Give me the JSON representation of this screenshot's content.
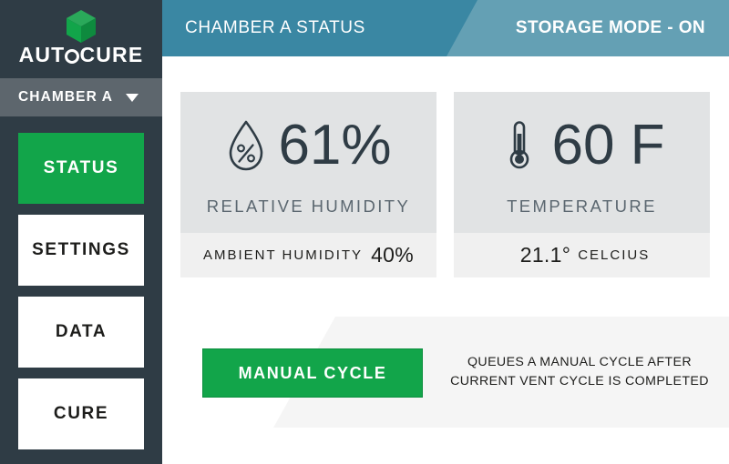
{
  "brand": {
    "logo_icon": "green-cube-icon",
    "name_part1": "AUT",
    "name_part2": "CURE",
    "full_name": "AUTOCURE",
    "accent_color": "#12a54a",
    "sidebar_color": "#2f3c45"
  },
  "sidebar": {
    "chamber_select": {
      "value": "CHAMBER A",
      "caret_icon": "chevron-down-icon"
    },
    "nav_items": [
      {
        "label": "STATUS",
        "active": true
      },
      {
        "label": "SETTINGS",
        "active": false
      },
      {
        "label": "DATA",
        "active": false
      },
      {
        "label": "CURE",
        "active": false
      }
    ]
  },
  "header": {
    "title": "CHAMBER A STATUS",
    "mode_status": "STORAGE MODE - ON",
    "left_color": "#3a87a3",
    "right_color": "#64a0b4"
  },
  "cards": [
    {
      "id": "humidity",
      "icon": "water-droplet-percent-icon",
      "value": "61%",
      "caption": "RELATIVE HUMIDITY",
      "footer_label": "AMBIENT HUMIDITY",
      "footer_value": "40%"
    },
    {
      "id": "temperature",
      "icon": "thermometer-icon",
      "value": "60 F",
      "caption": "TEMPERATURE",
      "footer_value": "21.1°",
      "footer_label": "CELCIUS"
    }
  ],
  "action": {
    "button_label": "MANUAL CYCLE",
    "hint_line1": "QUEUES A MANUAL CYCLE AFTER",
    "hint_line2": "CURRENT VENT CYCLE IS COMPLETED"
  }
}
